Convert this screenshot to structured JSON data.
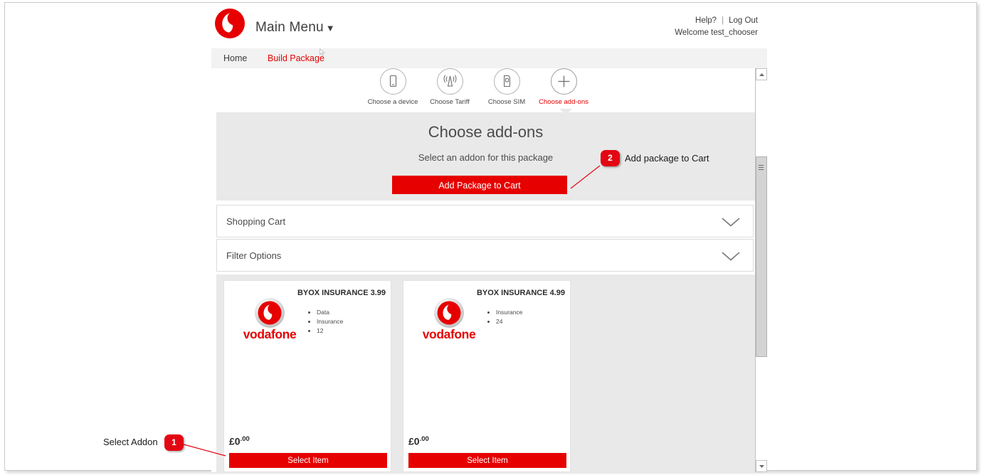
{
  "header": {
    "logo_icon": "vodafone-logo-icon",
    "main_menu_label": "Main Menu",
    "main_menu_caret": "▼",
    "help_label": "Help?",
    "separator": "|",
    "logout_label": "Log Out",
    "welcome_label": "Welcome test_chooser"
  },
  "nav": {
    "items": [
      {
        "label": "Home",
        "active": false
      },
      {
        "label": "Build Package",
        "active": true
      }
    ]
  },
  "wizard": {
    "steps": [
      {
        "label": "Choose a device",
        "icon": "phone-icon",
        "active": false
      },
      {
        "label": "Choose Tariff",
        "icon": "signal-icon",
        "active": false
      },
      {
        "label": "Choose SIM",
        "icon": "sim-card-icon",
        "active": false
      },
      {
        "label": "Choose add-ons",
        "icon": "plus-icon",
        "active": true
      }
    ]
  },
  "hero": {
    "title": "Choose add-ons",
    "subtitle": "Select an addon for this package",
    "cta_label": "Add Package to Cart"
  },
  "accordions": [
    {
      "label": "Shopping Cart",
      "chevron_icon": "chevron-down-icon"
    },
    {
      "label": "Filter Options",
      "chevron_icon": "chevron-down-icon"
    }
  ],
  "products": [
    {
      "title": "BYOX INSURANCE 3.99",
      "brand": "vodafone",
      "features": [
        "Data",
        "Insurance",
        "12"
      ],
      "price_currency": "£",
      "price_whole": "0",
      "price_decimal": ".00",
      "select_label": "Select Item"
    },
    {
      "title": "BYOX INSURANCE 4.99",
      "brand": "vodafone",
      "features": [
        "Insurance",
        "24"
      ],
      "price_currency": "£",
      "price_whole": "0",
      "price_decimal": ".00",
      "select_label": "Select Item"
    }
  ],
  "scrollbar": {
    "up_icon": "scroll-up-arrow-icon",
    "down_icon": "scroll-down-arrow-icon",
    "thumb_icon": "scrollbar-thumb"
  },
  "annotations": [
    {
      "number": "1",
      "text": "Select Addon"
    },
    {
      "number": "2",
      "text": "Add package to Cart"
    }
  ],
  "colors": {
    "brand_red": "#e60000",
    "callout_red": "#e30613",
    "panel_gray": "#e9e9e9",
    "nav_gray": "#f2f2f2"
  }
}
